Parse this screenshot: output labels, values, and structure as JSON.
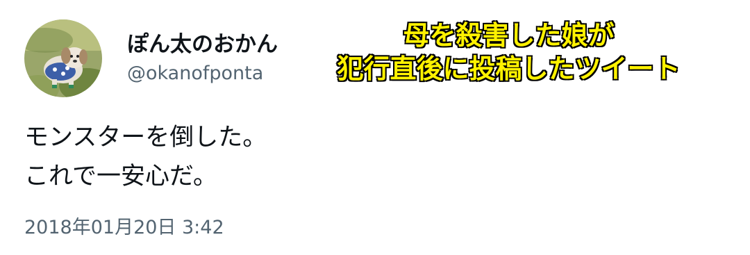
{
  "author": {
    "display_name": "ぽん太のおかん",
    "handle": "@okanofponta",
    "avatar_icon": "dog-photo-avatar-icon"
  },
  "caption": {
    "line1": "母を殺害した娘が",
    "line2": "犯行直後に投稿したツイート",
    "color": "#fff200",
    "outline_color": "#000000"
  },
  "tweet": {
    "line1": "モンスターを倒した。",
    "line2": "これで一安心だ。",
    "timestamp": "2018年01月20日 3:42"
  },
  "colors": {
    "text_primary": "#0f1419",
    "text_secondary": "#536471",
    "background": "#ffffff"
  }
}
